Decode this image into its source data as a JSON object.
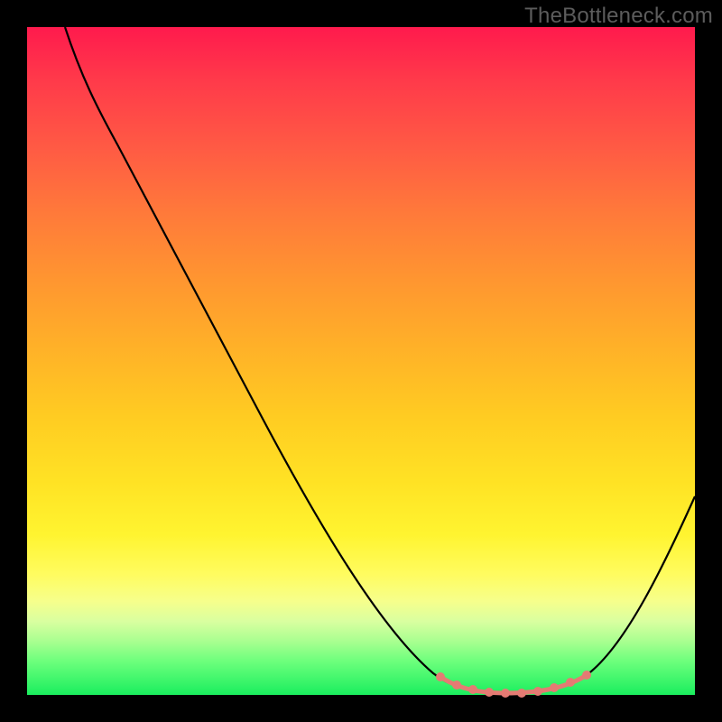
{
  "watermark": "TheBottleneck.com",
  "chart_data": {
    "type": "line",
    "title": "",
    "xlabel": "",
    "ylabel": "",
    "xlim": [
      0,
      100
    ],
    "ylim": [
      0,
      100
    ],
    "grid": false,
    "background": "rainbow-vertical-gradient",
    "series": [
      {
        "name": "bottleneck-curve",
        "color": "#000000",
        "x": [
          6,
          10,
          14,
          20,
          28,
          35,
          43,
          51,
          58,
          63,
          68,
          72,
          76,
          80,
          84,
          88,
          92,
          96,
          100
        ],
        "y": [
          100,
          92,
          85,
          75,
          61,
          49,
          35,
          22,
          11,
          5,
          1,
          0,
          0,
          1,
          4,
          10,
          18,
          25,
          30
        ]
      },
      {
        "name": "optimal-range-markers",
        "color": "#e47b73",
        "x": [
          62,
          64,
          67,
          69,
          72,
          74,
          77,
          79,
          81,
          84
        ],
        "y": [
          3,
          1.5,
          0.8,
          0.4,
          0.3,
          0.3,
          0.6,
          1.1,
          1.9,
          3
        ]
      }
    ],
    "annotations": [
      {
        "text": "TheBottleneck.com",
        "position": "top-right",
        "color": "#5c5c5c"
      }
    ]
  }
}
